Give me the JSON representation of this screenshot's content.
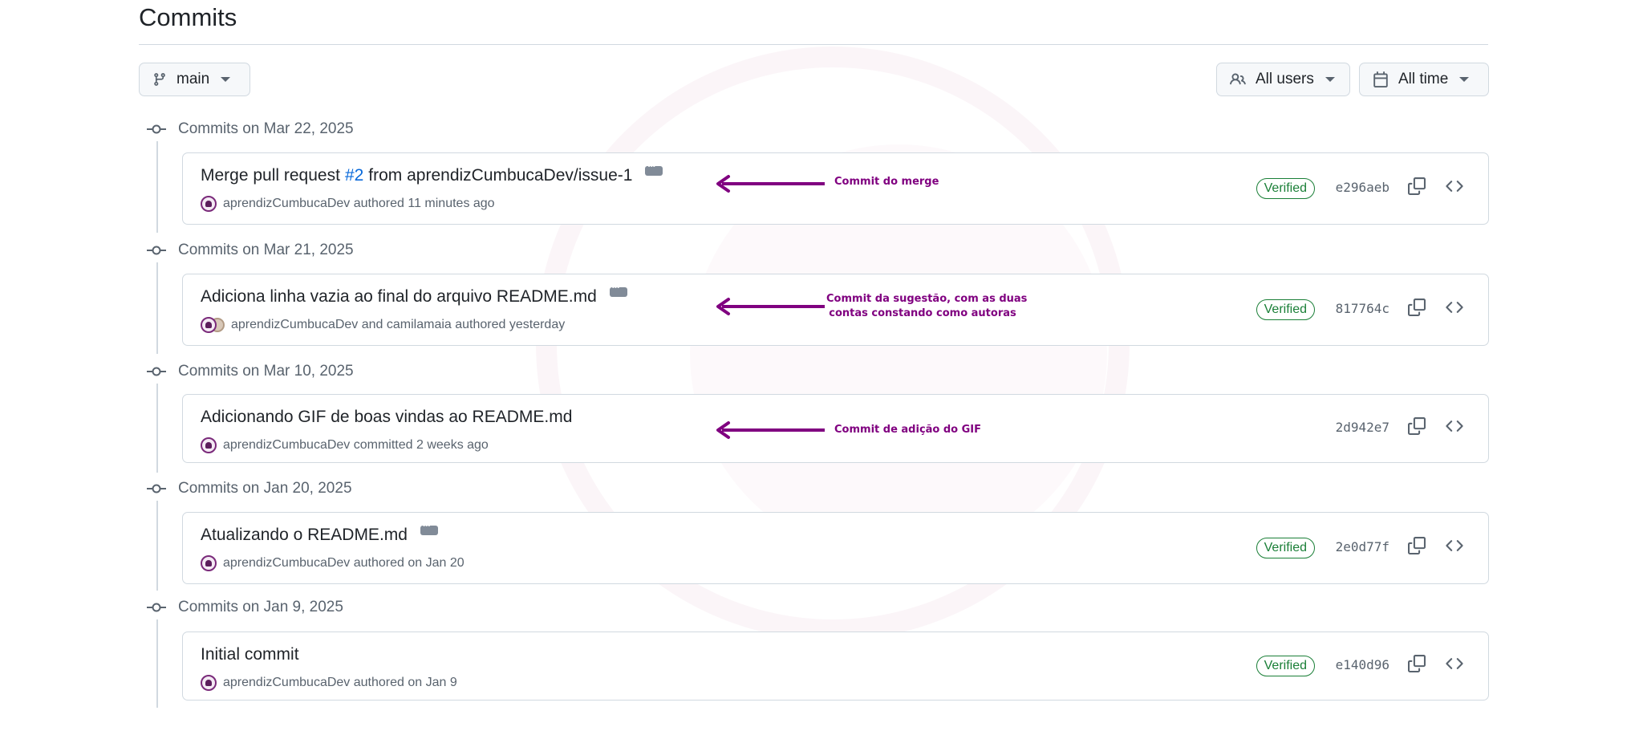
{
  "page": {
    "title": "Commits"
  },
  "filters": {
    "branch": "main",
    "users": "All users",
    "time": "All time"
  },
  "groups": [
    {
      "header": "Commits on Mar 22, 2025",
      "commit": {
        "title_pre": "Merge pull request ",
        "title_link": "#2",
        "title_post": " from aprendizCumbucaDev/issue-1",
        "meta": "aprendizCumbucaDev authored 11 minutes ago",
        "verified": "Verified",
        "sha": "e296aeb"
      }
    },
    {
      "header": "Commits on Mar 21, 2025",
      "commit": {
        "title": "Adiciona linha vazia ao final do arquivo README.md",
        "meta": "aprendizCumbucaDev and camilamaia authored yesterday",
        "verified": "Verified",
        "sha": "817764c"
      }
    },
    {
      "header": "Commits on Mar 10, 2025",
      "commit": {
        "title": "Adicionando GIF de boas vindas ao README.md",
        "meta": "aprendizCumbucaDev committed 2 weeks ago",
        "sha": "2d942e7"
      }
    },
    {
      "header": "Commits on Jan 20, 2025",
      "commit": {
        "title": "Atualizando o README.md",
        "meta": "aprendizCumbucaDev authored on Jan 20",
        "verified": "Verified",
        "sha": "2e0d77f"
      }
    },
    {
      "header": "Commits on Jan 9, 2025",
      "commit": {
        "title": "Initial commit",
        "meta": "aprendizCumbucaDev authored on Jan 9",
        "verified": "Verified",
        "sha": "e140d96"
      }
    }
  ],
  "annotations": {
    "merge": "Commit do merge",
    "suggestion_line1": "Commit da sugestão, com as duas",
    "suggestion_line2": "contas constando como autoras",
    "gif": "Commit de adição do GIF"
  },
  "colors": {
    "annotation": "#800080",
    "verified": "#1a7f37",
    "link": "#0969da"
  },
  "icons": {
    "branch": "git-branch-icon",
    "users": "people-icon",
    "time": "calendar-icon",
    "commit": "git-commit-icon",
    "copy": "copy-icon",
    "browse": "code-icon",
    "arrow": "arrow-left-icon"
  }
}
